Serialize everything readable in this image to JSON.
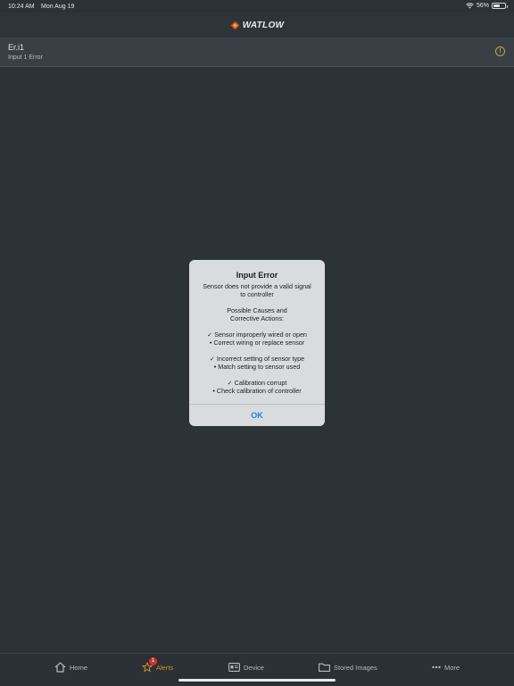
{
  "status": {
    "time": "10:24 AM",
    "date": "Mon Aug 19",
    "battery": "56%",
    "battery_level": 0.56
  },
  "header": {
    "logo_text": "WATLOW"
  },
  "alert": {
    "code": "Er.i1",
    "description": "Input 1 Error",
    "icon": "warning-circle-icon"
  },
  "dialog": {
    "title": "Input Error",
    "message": "Sensor does not provide a valid signal\nto controller\n\nPossible Causes and\nCorrective Actions:\n\n✓ Sensor improperly wired or open\n• Correct wiring or replace sensor\n\n✓ Incorrect setting of sensor type\n• Match setting to sensor used\n\n✓ Calibration corrupt\n• Check calibration of controller",
    "ok_label": "OK"
  },
  "tabbar": {
    "items": [
      {
        "label": "Home",
        "icon": "home-icon"
      },
      {
        "label": "Alerts",
        "icon": "alerts-icon",
        "badge": "1",
        "active": true
      },
      {
        "label": "Device",
        "icon": "device-icon"
      },
      {
        "label": "Stored Images",
        "icon": "folder-icon"
      },
      {
        "label": "More",
        "icon": "more-icon"
      }
    ]
  },
  "colors": {
    "background": "#2b3236",
    "accent": "#cf8f2d",
    "ok_blue": "#2a7be4",
    "badge_red": "#d2332f"
  }
}
